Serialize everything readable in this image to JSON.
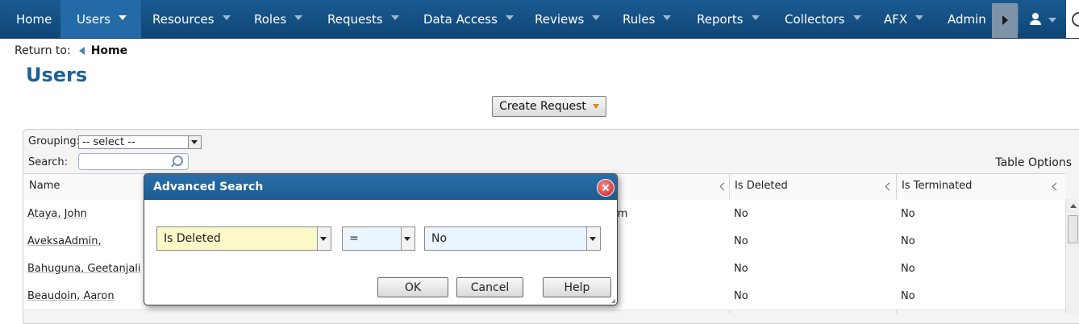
{
  "nav": {
    "items": [
      {
        "label": "Home",
        "dropdown": false,
        "active": false
      },
      {
        "label": "Users",
        "dropdown": true,
        "active": true
      },
      {
        "label": "Resources",
        "dropdown": true,
        "active": false
      },
      {
        "label": "Roles",
        "dropdown": true,
        "active": false
      },
      {
        "label": "Requests",
        "dropdown": true,
        "active": false
      },
      {
        "label": "Data Access",
        "dropdown": true,
        "active": false
      },
      {
        "label": "Reviews",
        "dropdown": true,
        "active": false
      },
      {
        "label": "Rules",
        "dropdown": true,
        "active": false
      },
      {
        "label": "Reports",
        "dropdown": true,
        "active": false
      },
      {
        "label": "Collectors",
        "dropdown": true,
        "active": false
      },
      {
        "label": "AFX",
        "dropdown": true,
        "active": false
      },
      {
        "label": "Admin",
        "dropdown": false,
        "active": false
      }
    ]
  },
  "breadcrumb": {
    "prefix": "Return to:",
    "link": "Home"
  },
  "page": {
    "title": "Users",
    "create_request_label": "Create Request"
  },
  "toolbar": {
    "grouping_label": "Grouping:",
    "grouping_value": "-- select --",
    "search_label": "Search:",
    "table_options_label": "Table Options"
  },
  "table": {
    "columns": [
      "Name",
      "Is Deleted",
      "Is Terminated"
    ],
    "rows": [
      {
        "name": "Ataya, John",
        "partial": "im",
        "deleted": "No",
        "terminated": "No"
      },
      {
        "name": "AveksaAdmin,",
        "partial": "",
        "deleted": "No",
        "terminated": "No"
      },
      {
        "name": "Bahuguna, Geetanjali",
        "partial": "",
        "deleted": "No",
        "terminated": "No"
      },
      {
        "name": "Beaudoin, Aaron",
        "partial": "",
        "deleted": "No",
        "terminated": "No"
      }
    ]
  },
  "dialog": {
    "title": "Advanced Search",
    "field_value": "Is Deleted",
    "operator_value": "=",
    "value_value": "No",
    "ok_label": "OK",
    "cancel_label": "Cancel",
    "help_label": "Help"
  }
}
